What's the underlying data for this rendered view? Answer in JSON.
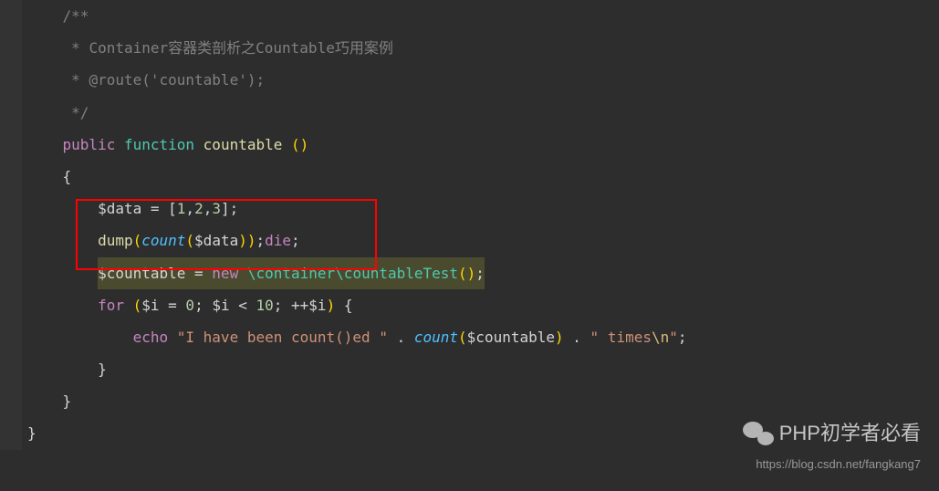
{
  "code": {
    "l1": "    /**",
    "l2_prefix": "     * ",
    "l2_text": "Container容器类剖析之Countable巧用案例",
    "l3_prefix": "     * ",
    "l3_text": "@route('countable');",
    "l4": "     */",
    "l5_public": "public",
    "l5_function": "function",
    "l5_name": "countable",
    "l5_paren": "()",
    "l6": "{",
    "l7_var": "$data",
    "l7_eq": " = ",
    "l7_br_open": "[",
    "l7_n1": "1",
    "l7_c": ",",
    "l7_n2": "2",
    "l7_n3": "3",
    "l7_br_close": "]",
    "l7_semi": ";",
    "l8_dump": "dump",
    "l8_po": "(",
    "l8_count": "count",
    "l8_var": "$data",
    "l8_pc": ")",
    "l8_die": "die",
    "l9_var": "$countable",
    "l9_eq": " = ",
    "l9_new": "new",
    "l9_class": "\\container\\countableTest",
    "l9_paren": "()",
    "l9_semi": ";",
    "l10_for": "for",
    "l10_po": "(",
    "l10_var": "$i",
    "l10_eq": " = ",
    "l10_n0": "0",
    "l10_semi": "; ",
    "l10_lt": " < ",
    "l10_n10": "10",
    "l10_inc": "++",
    "l10_pc": ")",
    "l10_brace": "{",
    "l11_echo": "echo",
    "l11_s1": "\"I have been count()ed \"",
    "l11_dot": " . ",
    "l11_count": "count",
    "l11_var": "$countable",
    "l11_s2": "\" times",
    "l11_esc": "\\n",
    "l11_s2end": "\"",
    "l12": "}",
    "l13": "}",
    "l14": "}"
  },
  "watermark": {
    "title": "PHP初学者必看",
    "url": "https://blog.csdn.net/fangkang7"
  }
}
